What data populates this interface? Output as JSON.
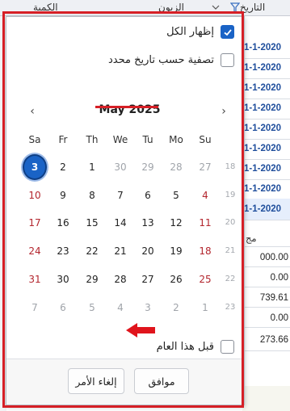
{
  "background": {
    "header": {
      "col_date": "التاريخ",
      "col_customer": "الزبون",
      "col_qty": "الكمية",
      "col_date_short": "مج"
    },
    "dates": [
      "1-1-2020",
      "1-1-2020",
      "1-1-2020",
      "1-1-2020",
      "1-1-2020",
      "1-1-2020",
      "1-1-2020",
      "1-1-2020",
      "1-1-2020"
    ],
    "numbers": [
      "000.00",
      "0.00",
      "739.61",
      "0.00",
      "273.66"
    ]
  },
  "filter": {
    "show_all_label": "إظهار الكل",
    "show_all_checked": true,
    "by_date_label": "تصفية حسب تاريخ محدد",
    "by_date_checked": false,
    "before_year_label": "قبل هذا العام",
    "before_year_checked": false
  },
  "calendar": {
    "month_title": "May 2025",
    "weekdays": [
      "Sa",
      "Fr",
      "Th",
      "We",
      "Tu",
      "Mo",
      "Su"
    ],
    "prev_symbol": "‹",
    "next_symbol": "›",
    "rows": [
      {
        "week": "18",
        "days": [
          {
            "d": "3",
            "t": "today"
          },
          {
            "d": "2",
            "t": ""
          },
          {
            "d": "1",
            "t": ""
          },
          {
            "d": "30",
            "t": "muted"
          },
          {
            "d": "29",
            "t": "muted"
          },
          {
            "d": "28",
            "t": "muted"
          },
          {
            "d": "27",
            "t": "muted"
          }
        ]
      },
      {
        "week": "19",
        "days": [
          {
            "d": "10",
            "t": "weekend"
          },
          {
            "d": "9",
            "t": ""
          },
          {
            "d": "8",
            "t": ""
          },
          {
            "d": "7",
            "t": ""
          },
          {
            "d": "6",
            "t": ""
          },
          {
            "d": "5",
            "t": ""
          },
          {
            "d": "4",
            "t": "weekend"
          }
        ]
      },
      {
        "week": "20",
        "days": [
          {
            "d": "17",
            "t": "weekend"
          },
          {
            "d": "16",
            "t": ""
          },
          {
            "d": "15",
            "t": ""
          },
          {
            "d": "14",
            "t": ""
          },
          {
            "d": "13",
            "t": ""
          },
          {
            "d": "12",
            "t": ""
          },
          {
            "d": "11",
            "t": "weekend"
          }
        ]
      },
      {
        "week": "21",
        "days": [
          {
            "d": "24",
            "t": "weekend"
          },
          {
            "d": "23",
            "t": ""
          },
          {
            "d": "22",
            "t": ""
          },
          {
            "d": "21",
            "t": ""
          },
          {
            "d": "20",
            "t": ""
          },
          {
            "d": "19",
            "t": ""
          },
          {
            "d": "18",
            "t": "weekend"
          }
        ]
      },
      {
        "week": "22",
        "days": [
          {
            "d": "31",
            "t": "weekend"
          },
          {
            "d": "30",
            "t": ""
          },
          {
            "d": "29",
            "t": ""
          },
          {
            "d": "28",
            "t": ""
          },
          {
            "d": "27",
            "t": ""
          },
          {
            "d": "26",
            "t": ""
          },
          {
            "d": "25",
            "t": "weekend"
          }
        ]
      },
      {
        "week": "23",
        "days": [
          {
            "d": "7",
            "t": "muted"
          },
          {
            "d": "6",
            "t": "muted"
          },
          {
            "d": "5",
            "t": "muted"
          },
          {
            "d": "4",
            "t": "muted"
          },
          {
            "d": "3",
            "t": "muted"
          },
          {
            "d": "2",
            "t": "muted"
          },
          {
            "d": "1",
            "t": "muted"
          }
        ]
      }
    ]
  },
  "buttons": {
    "ok": "موافق",
    "cancel": "إلغاء الأمر"
  },
  "colors": {
    "accent": "#1a63c6",
    "highlight": "#d61f26",
    "weekend": "#b3262e"
  }
}
